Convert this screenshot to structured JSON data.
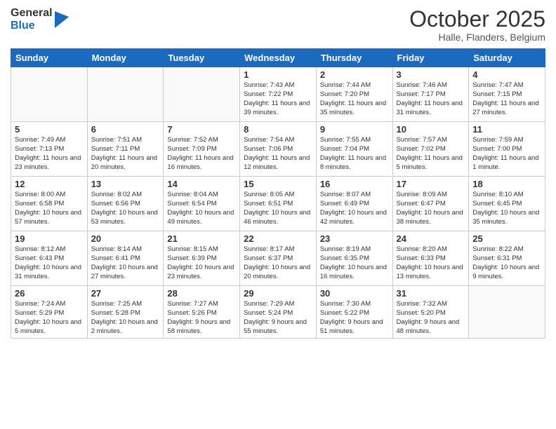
{
  "logo": {
    "general": "General",
    "blue": "Blue"
  },
  "header": {
    "month": "October 2025",
    "location": "Halle, Flanders, Belgium"
  },
  "weekdays": [
    "Sunday",
    "Monday",
    "Tuesday",
    "Wednesday",
    "Thursday",
    "Friday",
    "Saturday"
  ],
  "weeks": [
    [
      {
        "day": "",
        "sunrise": "",
        "sunset": "",
        "daylight": ""
      },
      {
        "day": "",
        "sunrise": "",
        "sunset": "",
        "daylight": ""
      },
      {
        "day": "",
        "sunrise": "",
        "sunset": "",
        "daylight": ""
      },
      {
        "day": "1",
        "sunrise": "7:43 AM",
        "sunset": "7:22 PM",
        "daylight": "11 hours and 39 minutes."
      },
      {
        "day": "2",
        "sunrise": "7:44 AM",
        "sunset": "7:20 PM",
        "daylight": "11 hours and 35 minutes."
      },
      {
        "day": "3",
        "sunrise": "7:46 AM",
        "sunset": "7:17 PM",
        "daylight": "11 hours and 31 minutes."
      },
      {
        "day": "4",
        "sunrise": "7:47 AM",
        "sunset": "7:15 PM",
        "daylight": "11 hours and 27 minutes."
      }
    ],
    [
      {
        "day": "5",
        "sunrise": "7:49 AM",
        "sunset": "7:13 PM",
        "daylight": "11 hours and 23 minutes."
      },
      {
        "day": "6",
        "sunrise": "7:51 AM",
        "sunset": "7:11 PM",
        "daylight": "11 hours and 20 minutes."
      },
      {
        "day": "7",
        "sunrise": "7:52 AM",
        "sunset": "7:09 PM",
        "daylight": "11 hours and 16 minutes."
      },
      {
        "day": "8",
        "sunrise": "7:54 AM",
        "sunset": "7:06 PM",
        "daylight": "11 hours and 12 minutes."
      },
      {
        "day": "9",
        "sunrise": "7:55 AM",
        "sunset": "7:04 PM",
        "daylight": "11 hours and 8 minutes."
      },
      {
        "day": "10",
        "sunrise": "7:57 AM",
        "sunset": "7:02 PM",
        "daylight": "11 hours and 5 minutes."
      },
      {
        "day": "11",
        "sunrise": "7:59 AM",
        "sunset": "7:00 PM",
        "daylight": "11 hours and 1 minute."
      }
    ],
    [
      {
        "day": "12",
        "sunrise": "8:00 AM",
        "sunset": "6:58 PM",
        "daylight": "10 hours and 57 minutes."
      },
      {
        "day": "13",
        "sunrise": "8:02 AM",
        "sunset": "6:56 PM",
        "daylight": "10 hours and 53 minutes."
      },
      {
        "day": "14",
        "sunrise": "8:04 AM",
        "sunset": "6:54 PM",
        "daylight": "10 hours and 49 minutes."
      },
      {
        "day": "15",
        "sunrise": "8:05 AM",
        "sunset": "6:51 PM",
        "daylight": "10 hours and 46 minutes."
      },
      {
        "day": "16",
        "sunrise": "8:07 AM",
        "sunset": "6:49 PM",
        "daylight": "10 hours and 42 minutes."
      },
      {
        "day": "17",
        "sunrise": "8:09 AM",
        "sunset": "6:47 PM",
        "daylight": "10 hours and 38 minutes."
      },
      {
        "day": "18",
        "sunrise": "8:10 AM",
        "sunset": "6:45 PM",
        "daylight": "10 hours and 35 minutes."
      }
    ],
    [
      {
        "day": "19",
        "sunrise": "8:12 AM",
        "sunset": "6:43 PM",
        "daylight": "10 hours and 31 minutes."
      },
      {
        "day": "20",
        "sunrise": "8:14 AM",
        "sunset": "6:41 PM",
        "daylight": "10 hours and 27 minutes."
      },
      {
        "day": "21",
        "sunrise": "8:15 AM",
        "sunset": "6:39 PM",
        "daylight": "10 hours and 23 minutes."
      },
      {
        "day": "22",
        "sunrise": "8:17 AM",
        "sunset": "6:37 PM",
        "daylight": "10 hours and 20 minutes."
      },
      {
        "day": "23",
        "sunrise": "8:19 AM",
        "sunset": "6:35 PM",
        "daylight": "10 hours and 16 minutes."
      },
      {
        "day": "24",
        "sunrise": "8:20 AM",
        "sunset": "6:33 PM",
        "daylight": "10 hours and 13 minutes."
      },
      {
        "day": "25",
        "sunrise": "8:22 AM",
        "sunset": "6:31 PM",
        "daylight": "10 hours and 9 minutes."
      }
    ],
    [
      {
        "day": "26",
        "sunrise": "7:24 AM",
        "sunset": "5:29 PM",
        "daylight": "10 hours and 5 minutes."
      },
      {
        "day": "27",
        "sunrise": "7:25 AM",
        "sunset": "5:28 PM",
        "daylight": "10 hours and 2 minutes."
      },
      {
        "day": "28",
        "sunrise": "7:27 AM",
        "sunset": "5:26 PM",
        "daylight": "9 hours and 58 minutes."
      },
      {
        "day": "29",
        "sunrise": "7:29 AM",
        "sunset": "5:24 PM",
        "daylight": "9 hours and 55 minutes."
      },
      {
        "day": "30",
        "sunrise": "7:30 AM",
        "sunset": "5:22 PM",
        "daylight": "9 hours and 51 minutes."
      },
      {
        "day": "31",
        "sunrise": "7:32 AM",
        "sunset": "5:20 PM",
        "daylight": "9 hours and 48 minutes."
      },
      {
        "day": "",
        "sunrise": "",
        "sunset": "",
        "daylight": ""
      }
    ]
  ]
}
